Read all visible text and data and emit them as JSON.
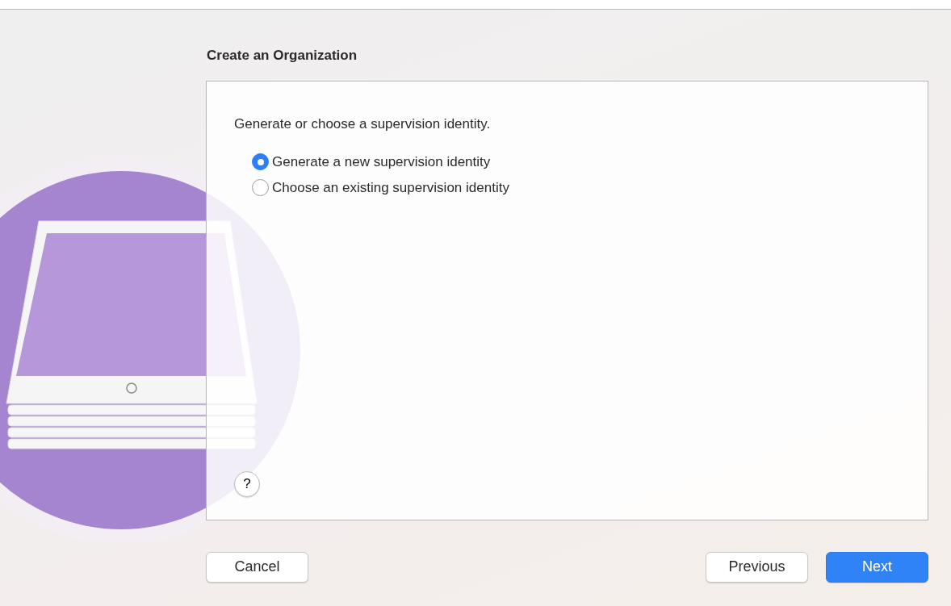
{
  "title": "Create an Organization",
  "prompt": "Generate or choose a supervision identity.",
  "options": [
    {
      "label": "Generate a new supervision identity",
      "selected": true
    },
    {
      "label": "Choose an existing supervision identity",
      "selected": false
    }
  ],
  "help": "?",
  "buttons": [
    {
      "label": "Cancel",
      "kind": "default"
    },
    {
      "label": "Previous",
      "kind": "default"
    },
    {
      "label": "Next",
      "kind": "primary"
    }
  ]
}
